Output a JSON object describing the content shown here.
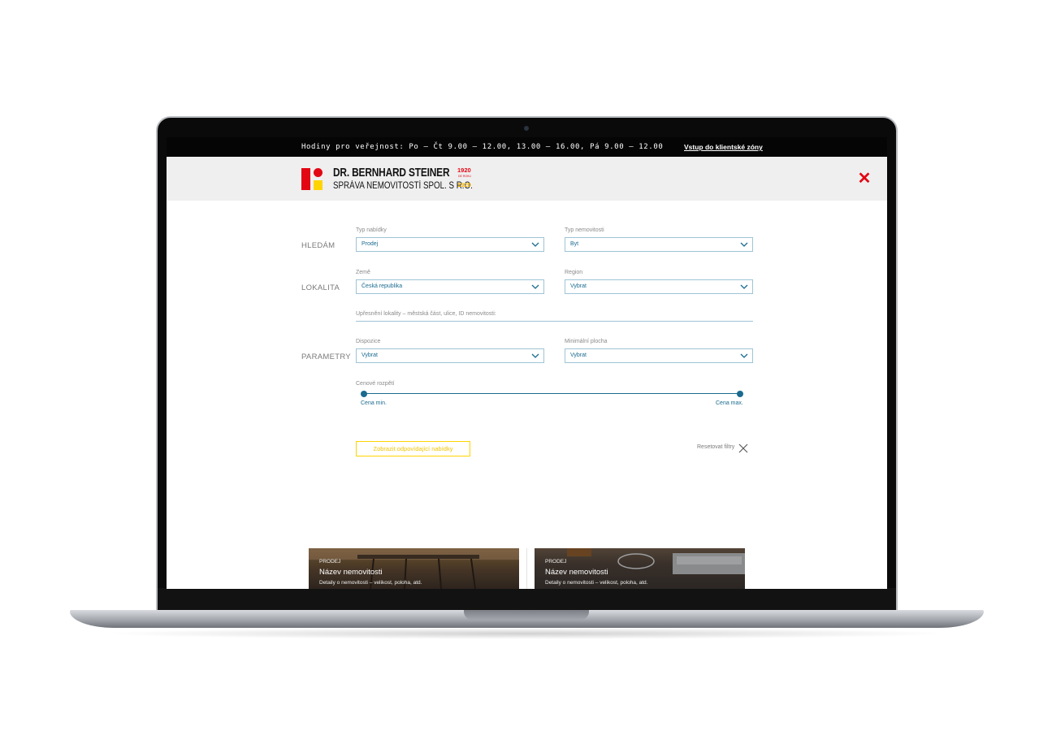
{
  "topbar": {
    "hours": "Hodiny pro veřejnost: Po – Čt 9.00 – 12.00, 13.00 – 16.00, Pá 9.00 – 12.00",
    "client_link": "Vstup do klientské zóny"
  },
  "brand": {
    "name": "DR. BERNHARD STEINER",
    "subtitle": "SPRÁVA NEMOVITOSTÍ SPOL. S R.O.",
    "year_top": "1920",
    "year_mid": "DE ROKU",
    "year_bottom": "1920",
    "colors": {
      "red": "#e30613",
      "yellow": "#ffd400"
    }
  },
  "header": {
    "close_icon": "close-icon"
  },
  "search": {
    "sections": {
      "hledam": "HLEDÁM",
      "lokalita": "LOKALITA",
      "parametry": "PARAMETRY"
    },
    "offer_type": {
      "label": "Typ nabídky",
      "value": "Prodej"
    },
    "property_type": {
      "label": "Typ nemovitosti",
      "value": "Byt"
    },
    "country": {
      "label": "Země",
      "value": "Česká republika"
    },
    "region": {
      "label": "Region",
      "value": "Vybrat"
    },
    "locality_refine": {
      "placeholder": "Upřesnění lokality – městská část, ulice, ID nemovitosti:"
    },
    "layout": {
      "label": "Dispozice",
      "value": "Vybrat"
    },
    "min_area": {
      "label": "Minimální plocha",
      "value": "Vybrat"
    },
    "price_range": {
      "label": "Cenové rozpětí",
      "min_label": "Cena min.",
      "max_label": "Cena max.",
      "min_fraction": 0,
      "max_fraction": 1
    },
    "submit_label": "Zobrazit odpovídající nabídky",
    "reset_label": "Resetovat filtry",
    "accent_color": "#1b6b8f"
  },
  "cards": [
    {
      "tag": "PRODEJ",
      "title": "Název nemovitosti",
      "desc": "Detaily o nemovitosti – velikost, poloha, atd."
    },
    {
      "tag": "PRODEJ",
      "title": "Název nemovitosti",
      "desc": "Detaily o nemovitosti – velikost, poloha, atd."
    }
  ]
}
